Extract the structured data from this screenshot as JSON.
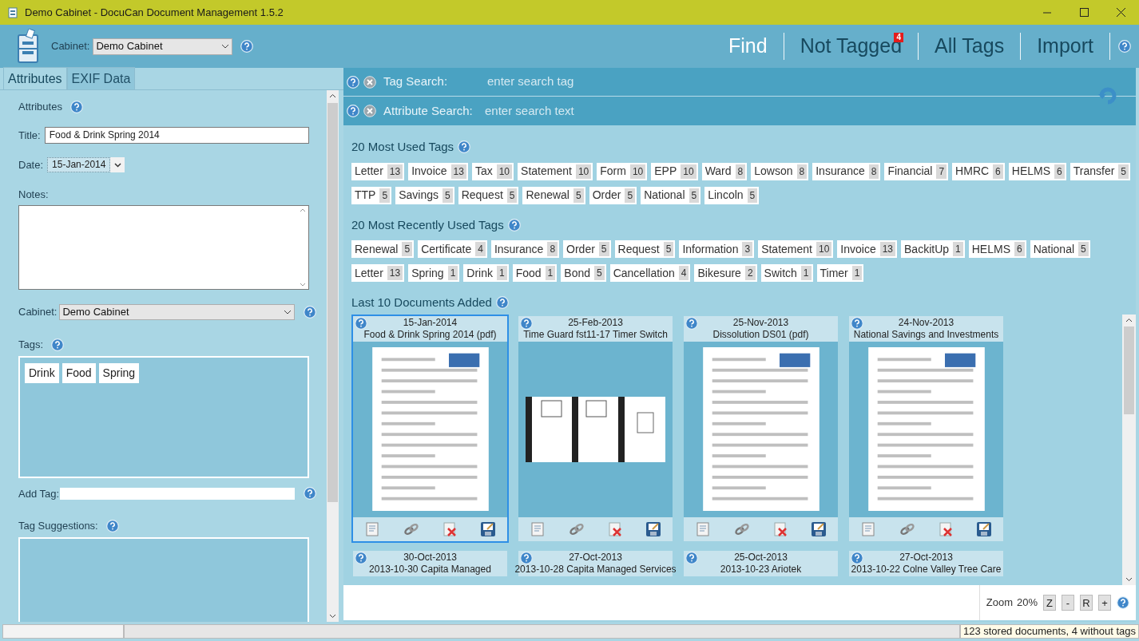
{
  "window": {
    "title": "Demo Cabinet - DocuCan Document Management 1.5.2"
  },
  "header": {
    "cabinet_label": "Cabinet:",
    "cabinet_value": "Demo Cabinet",
    "nav": [
      {
        "label": "Find",
        "selected": true
      },
      {
        "label": "Not Tagged",
        "selected": false,
        "badge": "4"
      },
      {
        "label": "All Tags",
        "selected": false
      },
      {
        "label": "Import",
        "selected": false
      }
    ]
  },
  "left_panel": {
    "tabs": [
      {
        "label": "Attributes",
        "selected": true
      },
      {
        "label": "EXIF Data",
        "selected": false
      }
    ],
    "section_title": "Attributes",
    "title_label": "Title:",
    "title_value": "Food & Drink Spring 2014",
    "date_label": "Date:",
    "date_value": "15-Jan-2014",
    "notes_label": "Notes:",
    "cabinet_label": "Cabinet:",
    "cabinet_value": "Demo Cabinet",
    "tags_label": "Tags:",
    "tags": [
      "Drink",
      "Food",
      "Spring"
    ],
    "add_tag_label": "Add Tag:",
    "suggestions_label": "Tag Suggestions:"
  },
  "search": {
    "tag_label": "Tag Search:",
    "tag_placeholder": "enter search tag",
    "attribute_label": "Attribute Search:",
    "attribute_placeholder": "enter search text"
  },
  "most_used": {
    "title": "20 Most Used Tags",
    "tags": [
      {
        "label": "Letter",
        "count": "13"
      },
      {
        "label": "Invoice",
        "count": "13"
      },
      {
        "label": "Tax",
        "count": "10"
      },
      {
        "label": "Statement",
        "count": "10"
      },
      {
        "label": "Form",
        "count": "10"
      },
      {
        "label": "EPP",
        "count": "10"
      },
      {
        "label": "Ward",
        "count": "8"
      },
      {
        "label": "Lowson",
        "count": "8"
      },
      {
        "label": "Insurance",
        "count": "8"
      },
      {
        "label": "Financial",
        "count": "7"
      },
      {
        "label": "HMRC",
        "count": "6"
      },
      {
        "label": "HELMS",
        "count": "6"
      },
      {
        "label": "Transfer",
        "count": "5"
      },
      {
        "label": "TTP",
        "count": "5"
      },
      {
        "label": "Savings",
        "count": "5"
      },
      {
        "label": "Request",
        "count": "5"
      },
      {
        "label": "Renewal",
        "count": "5"
      },
      {
        "label": "Order",
        "count": "5"
      },
      {
        "label": "National",
        "count": "5"
      },
      {
        "label": "Lincoln",
        "count": "5"
      }
    ]
  },
  "recent": {
    "title": "20 Most Recently Used Tags",
    "tags": [
      {
        "label": "Renewal",
        "count": "5"
      },
      {
        "label": "Certificate",
        "count": "4"
      },
      {
        "label": "Insurance",
        "count": "8"
      },
      {
        "label": "Order",
        "count": "5"
      },
      {
        "label": "Request",
        "count": "5"
      },
      {
        "label": "Information",
        "count": "3"
      },
      {
        "label": "Statement",
        "count": "10"
      },
      {
        "label": "Invoice",
        "count": "13"
      },
      {
        "label": "BackitUp",
        "count": "1"
      },
      {
        "label": "HELMS",
        "count": "6"
      },
      {
        "label": "National",
        "count": "5"
      },
      {
        "label": "Letter",
        "count": "13"
      },
      {
        "label": "Spring",
        "count": "1"
      },
      {
        "label": "Drink",
        "count": "1"
      },
      {
        "label": "Food",
        "count": "1"
      },
      {
        "label": "Bond",
        "count": "5"
      },
      {
        "label": "Cancellation",
        "count": "4"
      },
      {
        "label": "Bikesure",
        "count": "2"
      },
      {
        "label": "Switch",
        "count": "1"
      },
      {
        "label": "Timer",
        "count": "1"
      }
    ]
  },
  "documents": {
    "title": "Last 10 Documents Added",
    "items": [
      {
        "date": "15-Jan-2014",
        "title": "Food & Drink Spring 2014 (pdf)",
        "selected": true,
        "kind": "picture"
      },
      {
        "date": "25-Feb-2013",
        "title": "Time Guard fst11-17 Timer Switch",
        "selected": false,
        "kind": "picture"
      },
      {
        "date": "25-Nov-2013",
        "title": "Dissolution DS01 (pdf)",
        "selected": false,
        "kind": "picture"
      },
      {
        "date": "24-Nov-2013",
        "title": "National Savings and Investments",
        "selected": false,
        "kind": "picture"
      },
      {
        "date": "30-Oct-2013",
        "title": "2013-10-30 Capita Managed",
        "selected": false
      },
      {
        "date": "27-Oct-2013",
        "title": "2013-10-28 Capita Managed Services",
        "selected": false
      },
      {
        "date": "25-Oct-2013",
        "title": "2013-10-23 Ariotek",
        "selected": false
      },
      {
        "date": "27-Oct-2013",
        "title": "2013-10-22 Colne Valley Tree Care",
        "selected": false
      }
    ]
  },
  "zoom": {
    "label": "Zoom",
    "value": "20%",
    "buttons": [
      "Z",
      "-",
      "R",
      "+"
    ]
  },
  "status_bar": {
    "progress": {
      "level": 0
    },
    "text": "123 stored documents, 4 without tags"
  }
}
